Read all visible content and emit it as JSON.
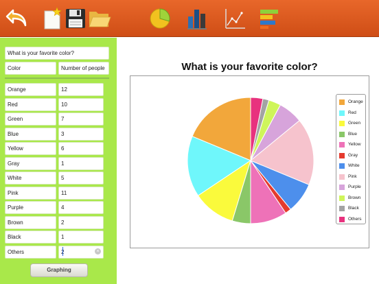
{
  "toolbar": {
    "buttons": [
      {
        "name": "back-button",
        "icon": "back-arrow-icon"
      },
      {
        "name": "new-document-button",
        "icon": "new-document-icon"
      },
      {
        "name": "save-button",
        "icon": "floppy-disk-icon"
      },
      {
        "name": "open-folder-button",
        "icon": "folder-icon"
      },
      {
        "name": "pie-chart-button",
        "icon": "pie-chart-icon"
      },
      {
        "name": "bar-chart-button",
        "icon": "bar-chart-icon"
      },
      {
        "name": "line-chart-button",
        "icon": "line-chart-icon"
      },
      {
        "name": "horizontal-bar-chart-button",
        "icon": "horizontal-bar-chart-icon"
      }
    ]
  },
  "form": {
    "title_value": "What is your favorite color?",
    "label_header": "Color",
    "value_header": "Number of people",
    "rows": [
      {
        "label": "Orange",
        "value": "12"
      },
      {
        "label": "Red",
        "value": "10"
      },
      {
        "label": "Green",
        "value": "7"
      },
      {
        "label": "Blue",
        "value": "3"
      },
      {
        "label": "Yellow",
        "value": "6"
      },
      {
        "label": "Gray",
        "value": "1"
      },
      {
        "label": "White",
        "value": "5"
      },
      {
        "label": "Pink",
        "value": "11"
      },
      {
        "label": "Purple",
        "value": "4"
      },
      {
        "label": "Brown",
        "value": "2"
      },
      {
        "label": "Black",
        "value": "1"
      },
      {
        "label": "Others",
        "value": "2"
      }
    ],
    "graphing_button": "Graphing"
  },
  "chart_data": {
    "type": "pie",
    "title": "What is your favorite color?",
    "categories": [
      "Orange",
      "Red",
      "Green",
      "Blue",
      "Yellow",
      "Gray",
      "White",
      "Pink",
      "Purple",
      "Brown",
      "Black",
      "Others"
    ],
    "values": [
      12,
      10,
      7,
      3,
      6,
      1,
      5,
      11,
      4,
      2,
      1,
      2
    ],
    "colors": [
      "#f2a73b",
      "#6ff7fb",
      "#fafa3c",
      "#8ac768",
      "#ee72b8",
      "#e53b2e",
      "#4d8fec",
      "#f6c3cd",
      "#d7a4db",
      "#cff55a",
      "#a3a3a3",
      "#e8327e"
    ],
    "legend_position": "right"
  }
}
